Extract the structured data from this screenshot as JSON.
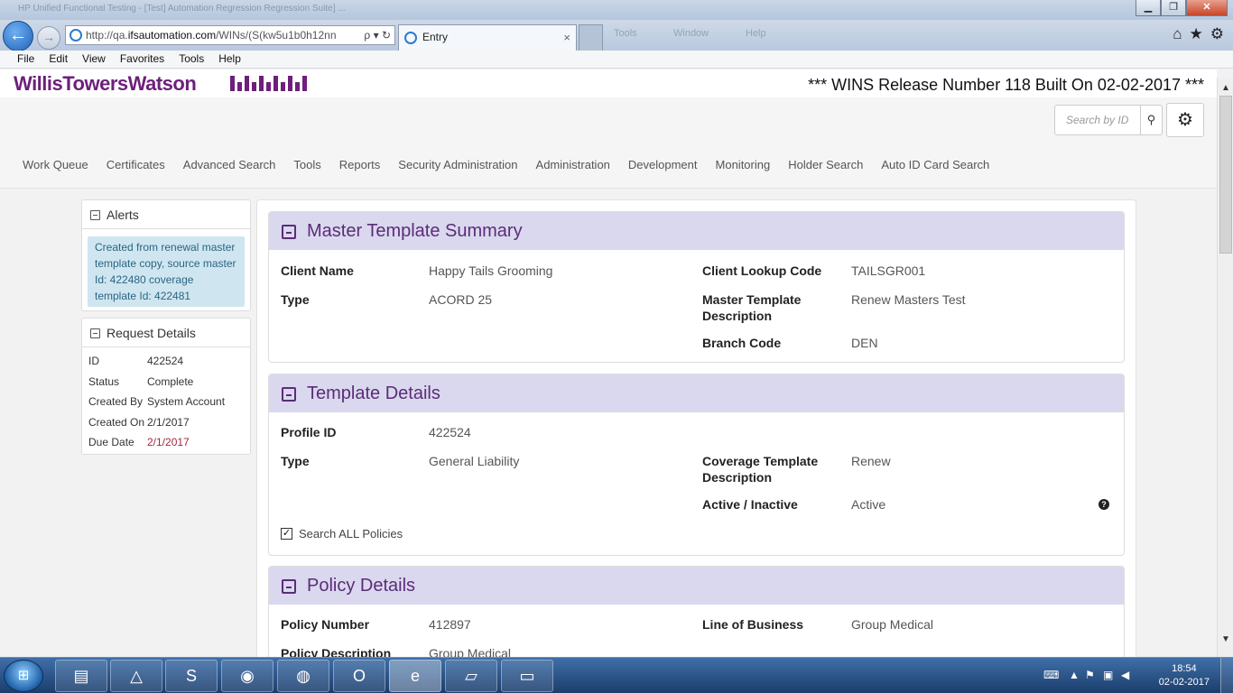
{
  "browser": {
    "title_faded": "HP Unified Functional Testing - [Test] Automation Regression Regression Suite] ...",
    "address_prefix": "http://qa.",
    "address_domain": "ifsautomation.com",
    "address_suffix": "/WINs/(S(kw5u1b0h12nn",
    "address_controls": "ρ ▾ ↻",
    "tab_title": "Entry",
    "tab_close": "×",
    "faded_menu": [
      "Tools",
      "Window",
      "Help"
    ],
    "menu": [
      "File",
      "Edit",
      "View",
      "Favorites",
      "Tools",
      "Help"
    ],
    "window_buttons": {
      "minimize": "▁",
      "restore": "❐",
      "close": "✕"
    }
  },
  "header": {
    "brand": "WillisTowersWatson",
    "release": "*** WINS Release Number 118 Built On 02-02-2017 ***",
    "search_placeholder": "Search by ID",
    "nav": [
      "Work Queue",
      "Certificates",
      "Advanced Search",
      "Tools",
      "Reports",
      "Security Administration",
      "Administration",
      "Development",
      "Monitoring",
      "Holder Search",
      "Auto ID Card Search"
    ]
  },
  "alerts": {
    "title": "Alerts",
    "message": "Created from renewal master template copy, source master Id: 422480 coverage template Id: 422481"
  },
  "request_details": {
    "title": "Request Details",
    "rows": [
      {
        "k": "ID",
        "v": "422524"
      },
      {
        "k": "Status",
        "v": "Complete"
      },
      {
        "k": "Created By",
        "v": "System Account"
      },
      {
        "k": "Created On",
        "v": "2/1/2017"
      },
      {
        "k": "Due Date",
        "v": "2/1/2017"
      }
    ]
  },
  "master_summary": {
    "title": "Master Template Summary",
    "client_name_label": "Client Name",
    "client_name": "Happy Tails Grooming",
    "client_lookup_label": "Client Lookup Code",
    "client_lookup": "TAILSGR001",
    "type_label": "Type",
    "type": "ACORD 25",
    "description_label": "Master Template Description",
    "description": "Renew Masters Test",
    "branch_label": "Branch Code",
    "branch": "DEN"
  },
  "template_details": {
    "title": "Template Details",
    "profile_label": "Profile ID",
    "profile": "422524",
    "type_label": "Type",
    "type": "General Liability",
    "cov_desc_label": "Coverage Template Description",
    "cov_desc": "Renew",
    "active_label": "Active / Inactive",
    "active": "Active",
    "search_all_label": "Search ALL Policies",
    "search_all_checked": true
  },
  "policy_details": {
    "title": "Policy Details",
    "number_label": "Policy Number",
    "number": "412897",
    "lob_label": "Line of Business",
    "lob": "Group Medical",
    "desc_label": "Policy Description",
    "desc": "Group Medical"
  },
  "taskbar": {
    "start": "⊞",
    "clock_time": "18:54",
    "clock_date": "02-02-2017"
  }
}
